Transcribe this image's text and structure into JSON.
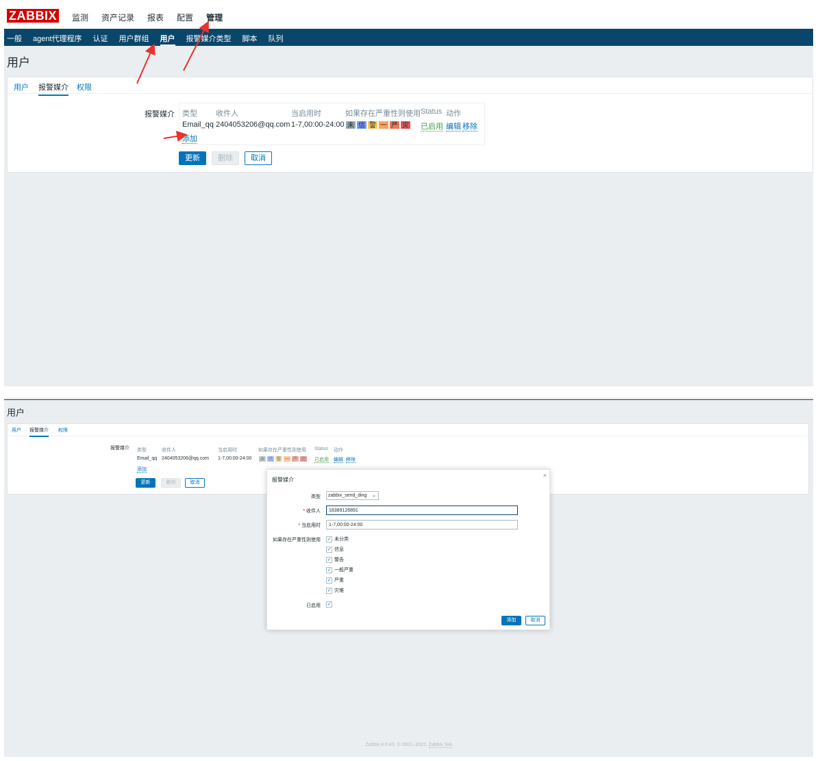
{
  "panel1": {
    "logo": "ZABBIX",
    "main_menu": [
      "监测",
      "资产记录",
      "报表",
      "配置",
      "管理"
    ],
    "sub_menu": [
      "一般",
      "agent代理程序",
      "认证",
      "用户群组",
      "用户",
      "报警媒介类型",
      "脚本",
      "队列"
    ],
    "page_title": "用户",
    "tabs": [
      "用户",
      "报警媒介",
      "权限"
    ],
    "media_label": "报警媒介",
    "columns": [
      "类型",
      "收件人",
      "当启用时",
      "如果存在严重性则使用",
      "Status",
      "动作"
    ],
    "row": {
      "type": "Email_qq",
      "recipient": "2404053206@qq.com",
      "when_active": "1-7,00:00-24:00",
      "severity": [
        "未",
        "信",
        "警",
        "一",
        "严",
        "灾"
      ],
      "status": "已启用",
      "edit": "编辑",
      "remove": "移除"
    },
    "add_link": "添加",
    "buttons": {
      "update": "更新",
      "delete": "删除",
      "cancel": "取消"
    }
  },
  "panel2": {
    "page_title": "用户",
    "tabs": [
      "用户",
      "报警媒介",
      "权限"
    ],
    "media_label": "报警媒介",
    "columns": [
      "类型",
      "收件人",
      "当启用时",
      "如果存在严重性则使用",
      "Status",
      "动作"
    ],
    "row": {
      "type": "Email_qq",
      "recipient": "2404053206@qq.com",
      "when_active": "1-7,00:00-24:00",
      "severity": [
        "未",
        "信",
        "警",
        "一",
        "严",
        "灾"
      ],
      "status": "已启用",
      "edit": "编辑",
      "remove": "移除"
    },
    "add_link": "添加",
    "buttons": {
      "update": "更新",
      "delete": "删除",
      "cancel": "取消"
    },
    "modal": {
      "title": "报警媒介",
      "close": "×",
      "type_label": "类型",
      "type_value": "zabbix_send_ding",
      "recipient_label": "收件人",
      "recipient_value": "18389126891",
      "when_label": "当启用时",
      "when_value": "1-7,00:00-24:00",
      "severity_label": "如果存在严重性则使用",
      "severities": [
        "未分类",
        "信息",
        "警告",
        "一般严重",
        "严重",
        "灾难"
      ],
      "enabled_label": "已启用",
      "add_button": "添加",
      "cancel_button": "取消"
    },
    "footer": {
      "version": "Zabbix 4.0.43. © 2001–2022, ",
      "company": "Zabbix SIA"
    }
  },
  "colors": {
    "logo_red": "#d40000",
    "nav_blue": "#0a466a",
    "link_blue": "#0275b8",
    "enabled_green": "#429e47",
    "arrow_red": "#e8322b",
    "severity": [
      "#97aab3",
      "#7499ff",
      "#ffc859",
      "#ffa059",
      "#e97659",
      "#e45959"
    ]
  }
}
